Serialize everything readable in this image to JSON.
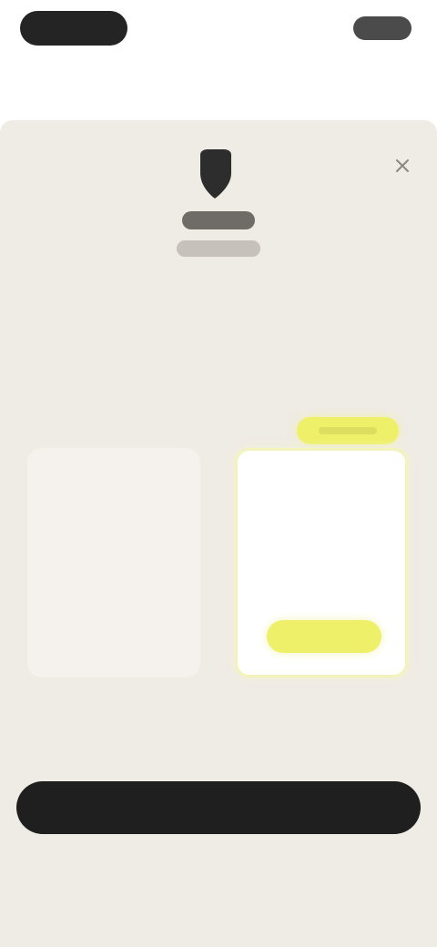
{
  "colors": {
    "page_bg": "#ffffff",
    "sheet_bg": "#efebe5",
    "accent": "#eef06a",
    "primary": "#1f1f1f"
  },
  "top_bar": {
    "left_pill_icon": "brand-pill",
    "right_pill_icon": "profile-pill"
  },
  "sheet": {
    "close_icon": "close-icon",
    "logo_icon": "logo-icon",
    "title": "",
    "description": "",
    "subline": "",
    "badge_label": "",
    "plans": [
      {
        "name": "",
        "price": "",
        "subtext": ""
      },
      {
        "name": "",
        "price": "",
        "subtext": "",
        "select_label": ""
      }
    ],
    "disclaimer": "",
    "cta_label": "",
    "footer": ""
  }
}
